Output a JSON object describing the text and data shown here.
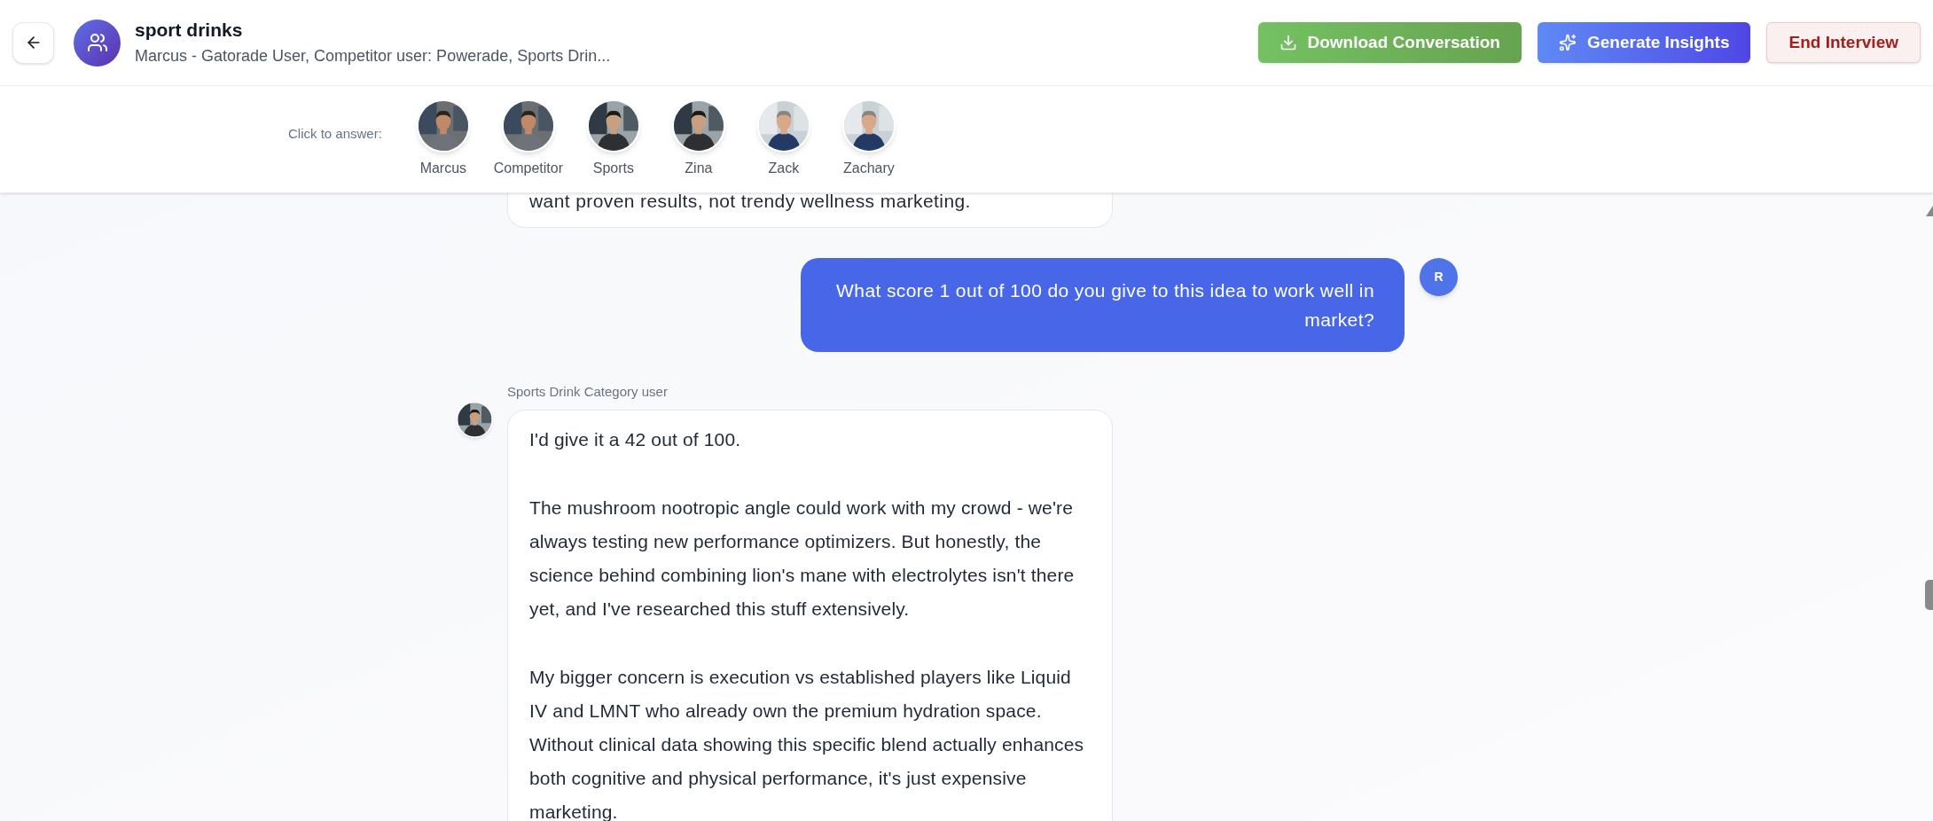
{
  "header": {
    "title": "sport drinks",
    "subtitle": "Marcus - Gatorade User, Competitor user: Powerade, Sports Drin...",
    "buttons": [
      {
        "kind": "download",
        "label": "Download Conversation"
      },
      {
        "kind": "insights",
        "label": "Generate Insights"
      },
      {
        "kind": "end",
        "label": "End Interview"
      }
    ]
  },
  "personas": {
    "prompt": "Click to answer:",
    "items": [
      {
        "name": "Marcus"
      },
      {
        "name": "Competitor"
      },
      {
        "name": "Sports"
      },
      {
        "name": "Zina"
      },
      {
        "name": "Zack"
      },
      {
        "name": "Zachary"
      }
    ]
  },
  "messages": [
    {
      "kind": "agent-tail",
      "paragraphs": [
        "want proven results, not trendy wellness marketing."
      ]
    },
    {
      "kind": "user",
      "avatar": "R",
      "paragraphs": [
        "What score 1 out of 100 do you give to this idea to work well in market?"
      ]
    },
    {
      "kind": "agent",
      "author": "Sports Drink Category user",
      "paragraphs": [
        "I'd give it a 42 out of 100.",
        "The mushroom nootropic angle could work with my crowd - we're always testing new performance optimizers. But honestly, the science behind combining lion's mane with electrolytes isn't there yet, and I've researched this stuff extensively.",
        "My bigger concern is execution vs established players like Liquid IV and LMNT who already own the premium hydration space. Without clinical data showing this specific blend actually enhances both cognitive and physical performance, it's just expensive marketing."
      ]
    }
  ]
}
